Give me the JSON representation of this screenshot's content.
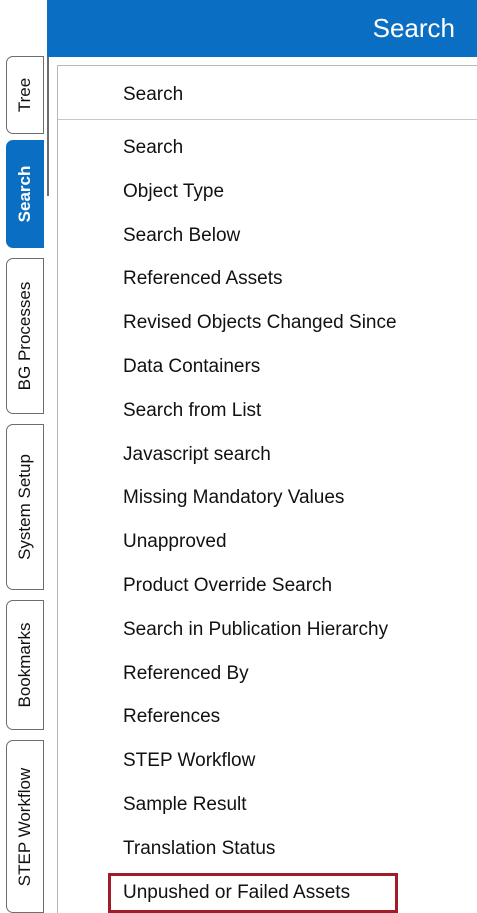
{
  "header": {
    "title": "Search"
  },
  "tabs": [
    {
      "label": "Tree",
      "active": false
    },
    {
      "label": "Search",
      "active": true
    },
    {
      "label": "BG Processes",
      "active": false
    },
    {
      "label": "System Setup",
      "active": false
    },
    {
      "label": "Bookmarks",
      "active": false
    },
    {
      "label": "STEP Workflow",
      "active": false
    }
  ],
  "menu": {
    "header_label": "Search",
    "items": [
      {
        "label": "Search"
      },
      {
        "label": "Object Type"
      },
      {
        "label": "Search Below"
      },
      {
        "label": "Referenced Assets"
      },
      {
        "label": "Revised Objects Changed Since"
      },
      {
        "label": "Data Containers"
      },
      {
        "label": "Search from List"
      },
      {
        "label": "Javascript search"
      },
      {
        "label": "Missing Mandatory Values"
      },
      {
        "label": "Unapproved"
      },
      {
        "label": "Product Override Search"
      },
      {
        "label": "Search in Publication Hierarchy"
      },
      {
        "label": "Referenced By"
      },
      {
        "label": "References"
      },
      {
        "label": "STEP Workflow"
      },
      {
        "label": "Sample Result"
      },
      {
        "label": "Translation Status"
      },
      {
        "label": "Unpushed or Failed Assets",
        "highlighted": true
      }
    ]
  },
  "colors": {
    "accent": "#0a6fc2",
    "highlight_border": "#a11c2a"
  }
}
